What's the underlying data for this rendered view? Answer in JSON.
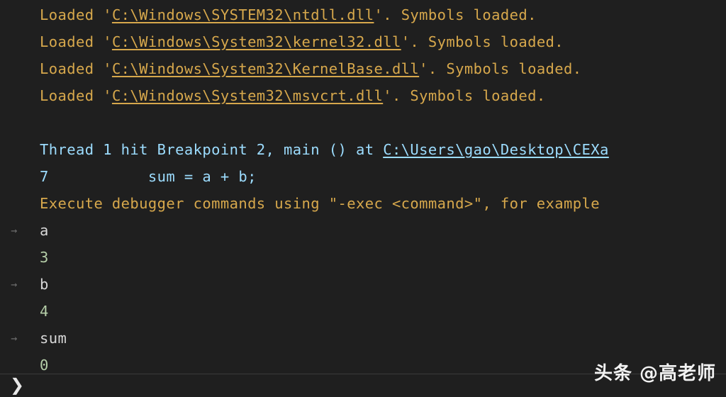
{
  "app": {
    "title": "VS Code Debug Console",
    "background_color": "#1f1f1f"
  },
  "colors": {
    "amber": "#d7a84c",
    "blue": "#9cdcfe",
    "white": "#d8d8d8",
    "green": "#b5cea8",
    "gutter_arrow": "#6e6e6e",
    "divider": "#3a3a3a"
  },
  "console": {
    "lines": [
      {
        "arrow": "",
        "segments": [
          {
            "text": "Loaded '",
            "style": "amber"
          },
          {
            "text": "C:\\Windows\\SYSTEM32\\ntdll.dll",
            "style": "link"
          },
          {
            "text": "'. Symbols loaded.",
            "style": "amber"
          }
        ]
      },
      {
        "arrow": "",
        "segments": [
          {
            "text": "Loaded '",
            "style": "amber"
          },
          {
            "text": "C:\\Windows\\System32\\kernel32.dll",
            "style": "link"
          },
          {
            "text": "'. Symbols loaded.",
            "style": "amber"
          }
        ]
      },
      {
        "arrow": "",
        "segments": [
          {
            "text": "Loaded '",
            "style": "amber"
          },
          {
            "text": "C:\\Windows\\System32\\KernelBase.dll",
            "style": "link"
          },
          {
            "text": "'. Symbols loaded.",
            "style": "amber"
          }
        ]
      },
      {
        "arrow": "",
        "segments": [
          {
            "text": "Loaded '",
            "style": "amber"
          },
          {
            "text": "C:\\Windows\\System32\\msvcrt.dll",
            "style": "link"
          },
          {
            "text": "'. Symbols loaded.",
            "style": "amber"
          }
        ]
      },
      {
        "arrow": "",
        "segments": []
      },
      {
        "arrow": "",
        "segments": [
          {
            "text": "Thread 1 hit Breakpoint 2, main () at ",
            "style": "blue"
          },
          {
            "text": "C:\\Users\\gao\\Desktop\\CEXa",
            "style": "bluelink"
          }
        ]
      },
      {
        "arrow": "",
        "segments": [
          {
            "text": "7           sum = a + b;",
            "style": "blue"
          }
        ]
      },
      {
        "arrow": "",
        "segments": [
          {
            "text": "Execute debugger commands using \"-exec <command>\", for example",
            "style": "amber"
          }
        ]
      },
      {
        "arrow": "→",
        "segments": [
          {
            "text": "a",
            "style": "white"
          }
        ]
      },
      {
        "arrow": "",
        "segments": [
          {
            "text": "3",
            "style": "green"
          }
        ]
      },
      {
        "arrow": "→",
        "segments": [
          {
            "text": "b",
            "style": "white"
          }
        ]
      },
      {
        "arrow": "",
        "segments": [
          {
            "text": "4",
            "style": "green"
          }
        ]
      },
      {
        "arrow": "→",
        "segments": [
          {
            "text": "sum",
            "style": "white"
          }
        ]
      },
      {
        "arrow": "",
        "segments": [
          {
            "text": "0",
            "style": "green"
          }
        ]
      }
    ]
  },
  "prompt": {
    "chevron": "❯",
    "input_value": "",
    "placeholder": ""
  },
  "watermark": {
    "text": "头条 @高老师"
  }
}
